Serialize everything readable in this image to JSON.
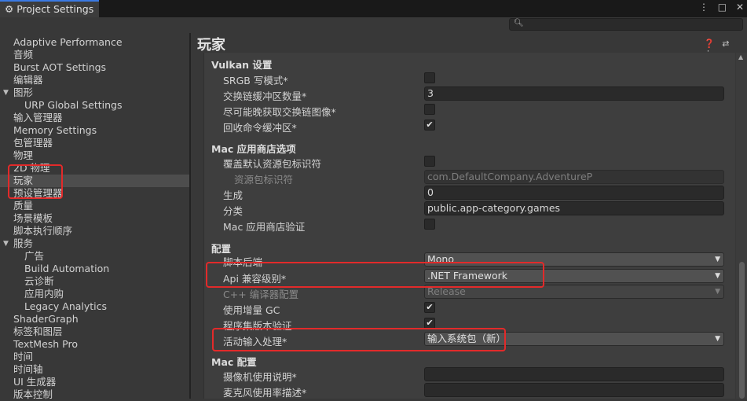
{
  "window": {
    "tab_title": "Project Settings",
    "gear_icon": "⚙",
    "controls": [
      "⋮",
      "□",
      "✕"
    ]
  },
  "search": {
    "placeholder": ""
  },
  "sidebar": {
    "items": [
      {
        "label": "Adaptive Performance"
      },
      {
        "label": "音频"
      },
      {
        "label": "Burst AOT Settings"
      },
      {
        "label": "编辑器"
      },
      {
        "label": "图形",
        "expanded": true
      },
      {
        "label": "URP Global Settings",
        "child": true
      },
      {
        "label": "输入管理器"
      },
      {
        "label": "Memory Settings"
      },
      {
        "label": "包管理器"
      },
      {
        "label": "物理"
      },
      {
        "label": "2D 物理"
      },
      {
        "label": "玩家",
        "selected": true
      },
      {
        "label": "预设管理器"
      },
      {
        "label": "质量"
      },
      {
        "label": "场景模板"
      },
      {
        "label": "脚本执行顺序"
      },
      {
        "label": "服务",
        "expanded": true
      },
      {
        "label": "广告",
        "child": true
      },
      {
        "label": "Build Automation",
        "child": true
      },
      {
        "label": "云诊断",
        "child": true
      },
      {
        "label": "应用内购",
        "child": true
      },
      {
        "label": "Legacy Analytics",
        "child": true
      },
      {
        "label": "ShaderGraph"
      },
      {
        "label": "标签和图层"
      },
      {
        "label": "TextMesh Pro"
      },
      {
        "label": "时间"
      },
      {
        "label": "时间轴"
      },
      {
        "label": "UI 生成器"
      },
      {
        "label": "版本控制"
      }
    ]
  },
  "page": {
    "title": "玩家",
    "icons": [
      "help-icon",
      "preset-icon",
      "more-icon"
    ]
  },
  "vulkan": {
    "header": "Vulkan 设置",
    "srgb_label": "SRGB 写模式*",
    "swap_buffers_label": "交换链缓冲区数量*",
    "swap_buffers_value": "3",
    "late_acquire_label": "尽可能晚获取交换链图像*",
    "recycle_label": "回收命令缓冲区*"
  },
  "mac_store": {
    "header": "Mac 应用商店选项",
    "override_label": "覆盖默认资源包标识符",
    "bundle_id_label": "资源包标识符",
    "bundle_id_value": "com.DefaultCompany.AdventureP",
    "build_label": "生成",
    "build_value": "0",
    "category_label": "分类",
    "category_value": "public.app-category.games",
    "validation_label": "Mac 应用商店验证"
  },
  "config": {
    "header": "配置",
    "scripting_backend_label": "脚本后端",
    "scripting_backend_value": "Mono",
    "api_level_label": "Api 兼容级别*",
    "api_level_value": ".NET Framework",
    "cpp_config_label": "C++ 编译器配置",
    "cpp_config_value": "Release",
    "incremental_gc_label": "使用增量 GC",
    "assembly_validation_label": "程序集版本验证",
    "input_handling_label": "活动输入处理*",
    "input_handling_value": "输入系统包（新）"
  },
  "mac_config": {
    "header": "Mac 配置",
    "camera_usage_label": "摄像机使用说明*",
    "camera_usage_value": "",
    "mic_usage_label": "麦克风使用率描述*",
    "mic_usage_value": ""
  },
  "checkbox_states": {
    "srgb": false,
    "late_acquire": false,
    "recycle": true,
    "override_bundle": false,
    "mac_validation": false,
    "incremental_gc": true,
    "assembly_validation": true
  },
  "check_glyph": "✔",
  "caret_glyph": "▼",
  "expand_glyph": "▼",
  "annotation_color": "#e22a2a"
}
